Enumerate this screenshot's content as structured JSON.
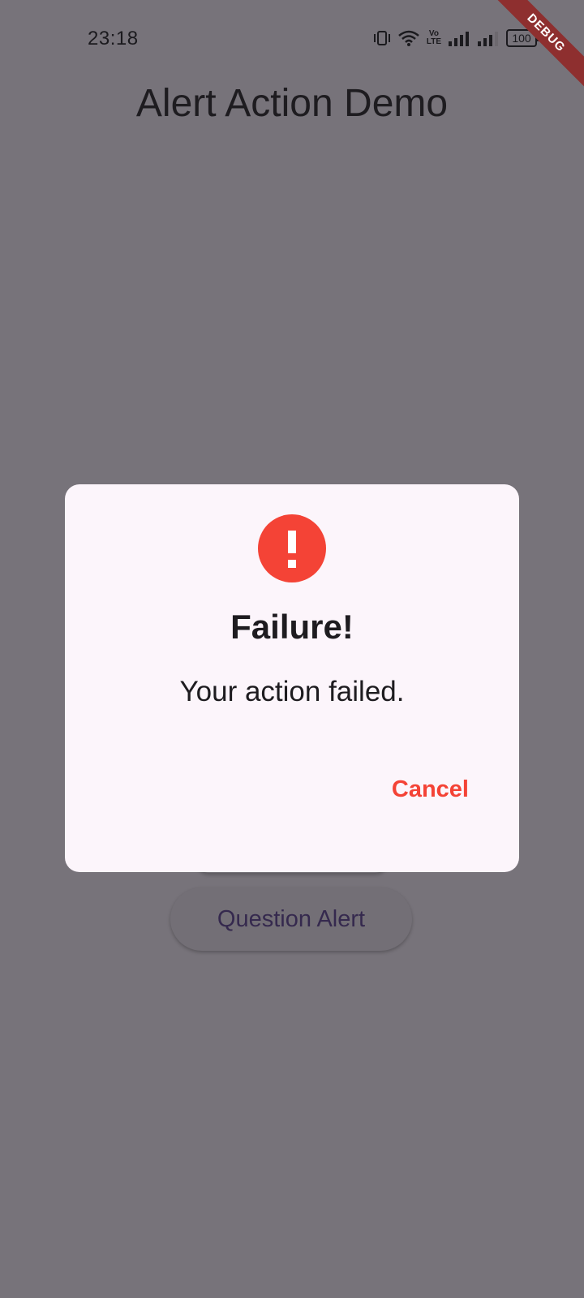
{
  "status_bar": {
    "time": "23:18",
    "volte_line1": "Vo",
    "volte_line2": "LTE",
    "battery": "100"
  },
  "debug_banner": "DEBUG",
  "app": {
    "title": "Alert Action Demo",
    "question_button_label": "Question Alert"
  },
  "dialog": {
    "icon": "error-icon",
    "title": "Failure!",
    "message": "Your action failed.",
    "cancel_label": "Cancel"
  },
  "colors": {
    "scrim_background": "#77737a",
    "dialog_background": "#fcf5fb",
    "error_red": "#f44336",
    "button_text": "#35294e"
  }
}
